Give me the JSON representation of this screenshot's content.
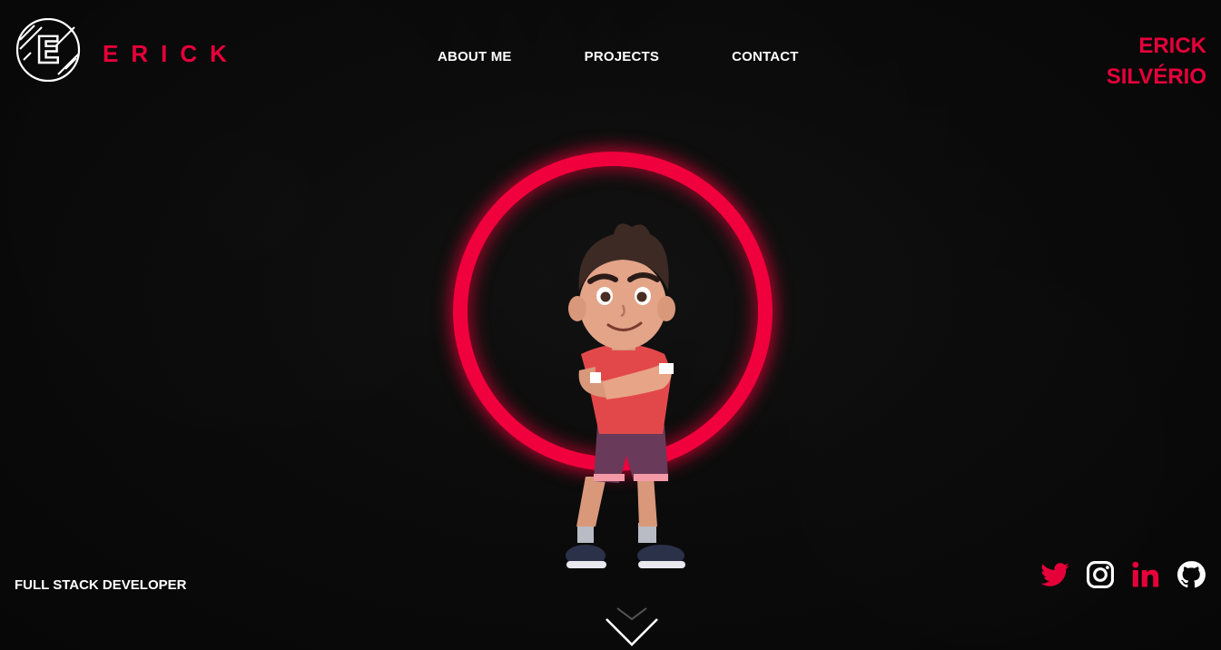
{
  "brand": {
    "logo_letter": "E",
    "word": "ERICK"
  },
  "nav": {
    "items": [
      "ABOUT ME",
      "PROJECTS",
      "CONTACT"
    ]
  },
  "name_right": {
    "line1": "ERICK",
    "line2": "SILVÉRIO"
  },
  "hero": {
    "role": "FULL STACK DEVELOPER"
  },
  "socials": [
    {
      "name": "twitter",
      "icon": "twitter-icon",
      "color": "#e6003a"
    },
    {
      "name": "instagram",
      "icon": "instagram-icon",
      "color": "#ffffff"
    },
    {
      "name": "linkedin",
      "icon": "linkedin-icon",
      "color": "#e6003a"
    },
    {
      "name": "github",
      "icon": "github-icon",
      "color": "#ffffff"
    }
  ],
  "colors": {
    "accent": "#e6003a",
    "background": "#0b0b0b",
    "text": "#ffffff"
  }
}
